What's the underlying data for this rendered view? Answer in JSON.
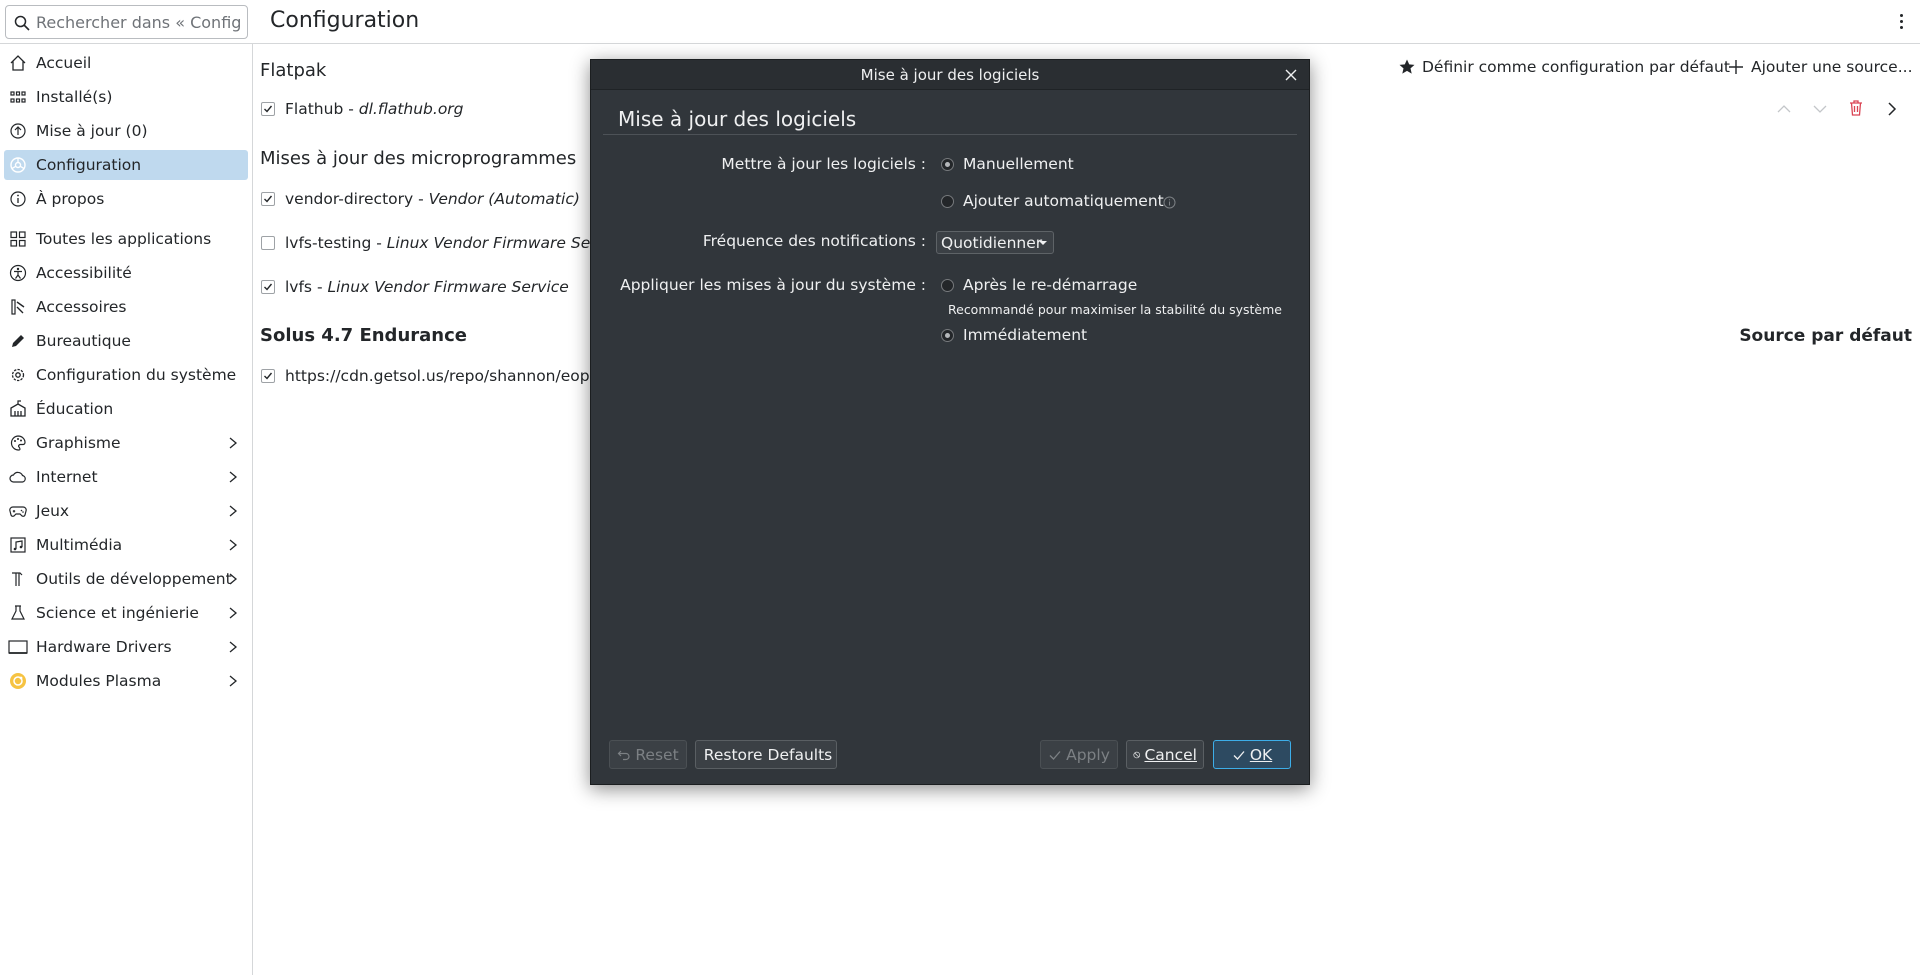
{
  "header": {
    "search_placeholder": "Rechercher dans « Configu...",
    "page_title": "Configuration",
    "menu_icon": "kebab-menu-icon"
  },
  "sidebar": {
    "top_items": [
      {
        "label": "Accueil",
        "icon": "home-icon"
      },
      {
        "label": "Installé(s)",
        "icon": "installed-grid-icon"
      },
      {
        "label": "Mise à jour (0)",
        "icon": "update-arrow-icon"
      },
      {
        "label": "Configuration",
        "icon": "settings-icon",
        "active": true
      },
      {
        "label": "À propos",
        "icon": "info-icon"
      }
    ],
    "categories": [
      {
        "label": "Toutes les applications",
        "icon": "all-apps-icon",
        "expandable": false
      },
      {
        "label": "Accessibilité",
        "icon": "accessibility-icon",
        "expandable": false
      },
      {
        "label": "Accessoires",
        "icon": "accessories-icon",
        "expandable": false
      },
      {
        "label": "Bureautique",
        "icon": "office-pen-icon",
        "expandable": false
      },
      {
        "label": "Configuration du système",
        "icon": "system-gear-icon",
        "expandable": false
      },
      {
        "label": "Éducation",
        "icon": "education-icon",
        "expandable": false
      },
      {
        "label": "Graphisme",
        "icon": "graphics-palette-icon",
        "expandable": true
      },
      {
        "label": "Internet",
        "icon": "cloud-icon",
        "expandable": true
      },
      {
        "label": "Jeux",
        "icon": "gamepad-icon",
        "expandable": true
      },
      {
        "label": "Multimédia",
        "icon": "multimedia-icon",
        "expandable": true
      },
      {
        "label": "Outils de développement",
        "icon": "dev-tools-icon",
        "expandable": true
      },
      {
        "label": "Science et ingénierie",
        "icon": "flask-icon",
        "expandable": true
      },
      {
        "label": "Hardware Drivers",
        "icon": "hardware-icon",
        "expandable": true
      },
      {
        "label": "Modules Plasma",
        "icon": "plasma-icon",
        "expandable": true
      }
    ]
  },
  "main": {
    "toolbar": {
      "set_default_label": "Définir comme configuration par défaut",
      "add_source_label": "Ajouter une source..."
    },
    "sections": {
      "flatpak_title": "Flatpak",
      "firmware_title": "Mises à jour des microprogrammes",
      "solus_title": "Solus 4.7 Endurance",
      "default_source_label": "Source par défaut"
    },
    "sources": {
      "flathub": {
        "name": "Flathub",
        "sep": " - ",
        "detail": "dl.flathub.org",
        "checked": true
      },
      "vendor_directory": {
        "name": "vendor-directory",
        "sep": " - ",
        "detail": "Vendor (Automatic)",
        "checked": true
      },
      "lvfs_testing": {
        "name": "lvfs-testing",
        "sep": " - ",
        "detail": "Linux Vendor Firmware Service (t",
        "checked": false
      },
      "lvfs": {
        "name": "lvfs",
        "sep": " - ",
        "detail": "Linux Vendor Firmware Service",
        "checked": true
      },
      "solus_repo": {
        "name": "https://cdn.getsol.us/repo/shannon/eopkg-",
        "checked": true
      }
    }
  },
  "dialog": {
    "window_title": "Mise à jour des logiciels",
    "heading": "Mise à jour des logiciels",
    "update_label": "Mettre à jour les logiciels :",
    "update_manual": "Manuellement",
    "update_auto": "Ajouter automatiquement",
    "update_selected": "manual",
    "frequency_label": "Fréquence des notifications :",
    "frequency_value": "Quotidienner",
    "apply_label": "Appliquer les mises à jour du système :",
    "apply_after_restart": "Après le re-démarrage",
    "apply_hint": "Recommandé pour maximiser la stabilité du système",
    "apply_immediately": "Immédiatement",
    "apply_selected": "immediately",
    "buttons": {
      "reset": "Reset",
      "restore_defaults": "Restore Defaults",
      "apply": "Apply",
      "cancel": "Cancel",
      "ok": "OK"
    }
  },
  "colors": {
    "accent": "#3daee9",
    "active_bg": "#bfd9ee",
    "dialog_bg": "#31363b",
    "danger": "#da4453"
  }
}
